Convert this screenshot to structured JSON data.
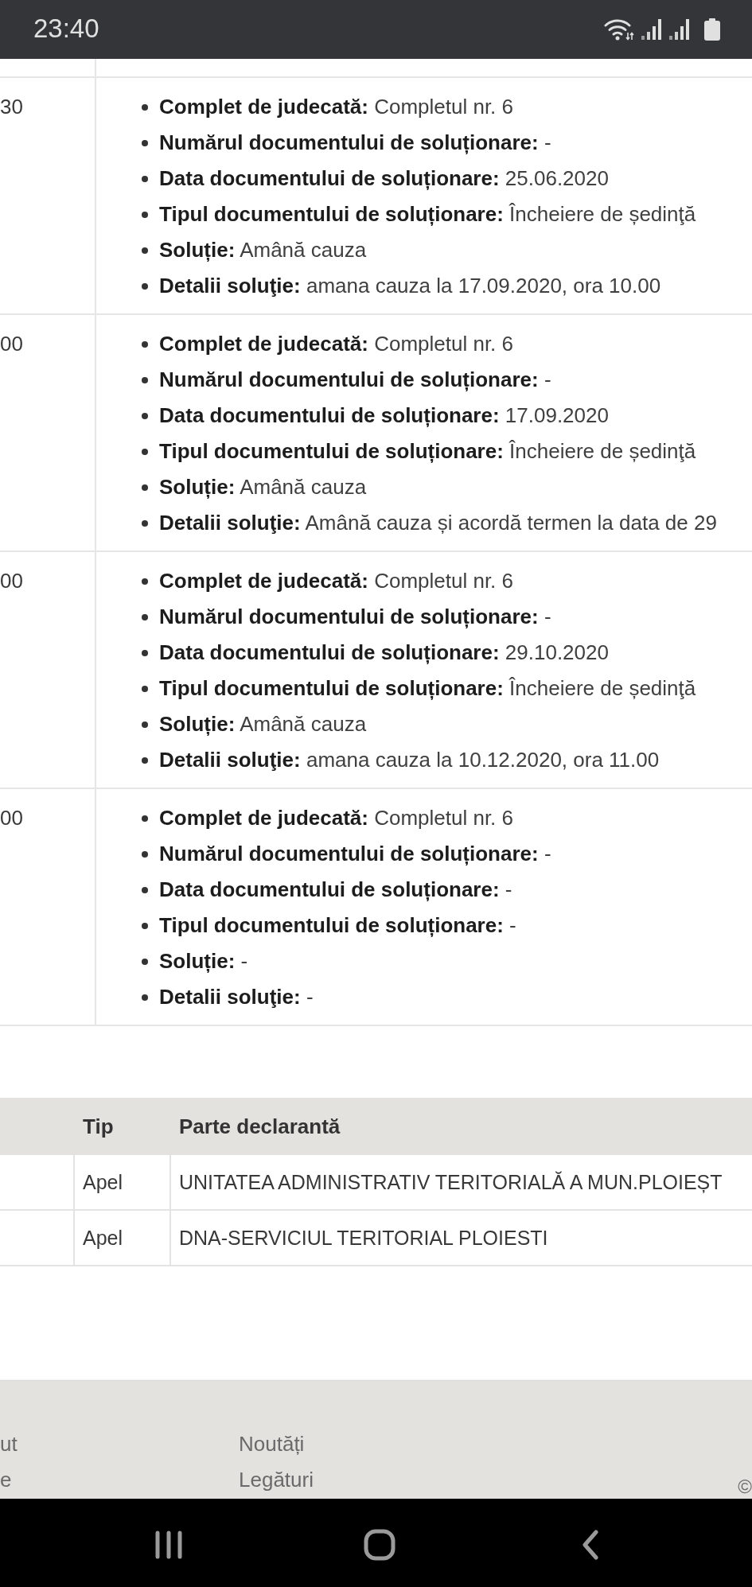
{
  "status_bar": {
    "time": "23:40"
  },
  "hearings_table": {
    "rows": [
      {
        "time": "30",
        "details": [
          "**Complet de judecată:** Completul nr. 6",
          "**Numărul documentului de soluționare:** -",
          "**Data documentului de soluționare:** 25.06.2020",
          "**Tipul documentului de soluționare:** Încheiere de ședinţă",
          "**Soluție:** Amână cauza",
          "**Detalii soluţie:** amana cauza la 17.09.2020, ora 10.00"
        ]
      },
      {
        "time": "00",
        "details": [
          "**Complet de judecată:** Completul nr. 6",
          "**Numărul documentului de soluționare:** -",
          "**Data documentului de soluționare:** 17.09.2020",
          "**Tipul documentului de soluționare:** Încheiere de ședinţă",
          "**Soluție:** Amână cauza",
          "**Detalii soluţie:** Amână cauza și acordă termen la data de 29"
        ]
      },
      {
        "time": "00",
        "details": [
          "**Complet de judecată:** Completul nr. 6",
          "**Numărul documentului de soluționare:** -",
          "**Data documentului de soluționare:** 29.10.2020",
          "**Tipul documentului de soluționare:** Încheiere de ședinţă",
          "**Soluție:** Amână cauza",
          "**Detalii soluţie:** amana cauza la 10.12.2020, ora 11.00"
        ]
      },
      {
        "time": "00",
        "details": [
          "**Complet de judecată:** Completul nr. 6",
          "**Numărul documentului de soluționare:** -",
          "**Data documentului de soluționare:** -",
          "**Tipul documentului de soluționare:** -",
          "**Soluție:** -",
          "**Detalii soluţie:** -"
        ]
      }
    ]
  },
  "appeals_table": {
    "columns": [
      "Tip",
      "Parte declarantă"
    ],
    "rows": [
      {
        "tip": "Apel",
        "parte_declaranta": "UNITATEA ADMINISTRATIV TERITORIALĂ A MUN.PLOIEȘT"
      },
      {
        "tip": "Apel",
        "parte_declaranta": "DNA-SERVICIUL TERITORIAL PLOIESTI"
      }
    ]
  },
  "footer": {
    "column_1": [
      "ut",
      "e"
    ],
    "column_2": [
      "Noutăți",
      "Legături"
    ],
    "copyright": "©"
  }
}
